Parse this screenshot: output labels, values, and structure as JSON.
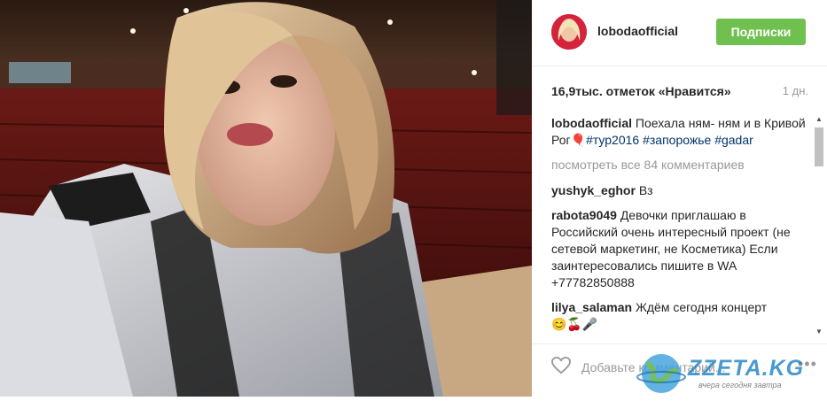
{
  "post": {
    "username": "lobodaofficial",
    "follow_label": "Подписки",
    "likes": "16,9тыс. отметок «Нравится»",
    "time": "1 дн.",
    "caption": {
      "user": "lobodaofficial",
      "text": "Поехала ням- ням и в Кривой Рог",
      "emoji": "🎈",
      "tags": [
        "#тур2016",
        "#запорожье",
        "#gadar"
      ]
    },
    "view_all": "посмотреть все 84 комментариев",
    "comments": [
      {
        "user": "yushyk_eghor",
        "text": "Вз"
      },
      {
        "user": "rabota9049",
        "text": "Девочки приглашаю в Российский очень интересный проект (не сетевой маркетинг, не Косметика) Если заинтересовались пишите в WA +77782850888"
      },
      {
        "user": "lilya_salaman",
        "text": "Ждём сегодня концерт",
        "emoji": "😊🍒🎤"
      }
    ],
    "add_comment_placeholder": "Добавьте комментарий..."
  },
  "watermark": {
    "brand": "ZZETA.KG",
    "tagline": "вчера сегодня завтра"
  },
  "icons": {
    "like": "heart-outline-icon",
    "more": "more-dots-icon",
    "scroll_up": "arrow-up-icon",
    "scroll_down": "arrow-down-icon"
  },
  "colors": {
    "follow_button": "#70c050",
    "tag_link": "#003569",
    "muted": "#999999"
  }
}
